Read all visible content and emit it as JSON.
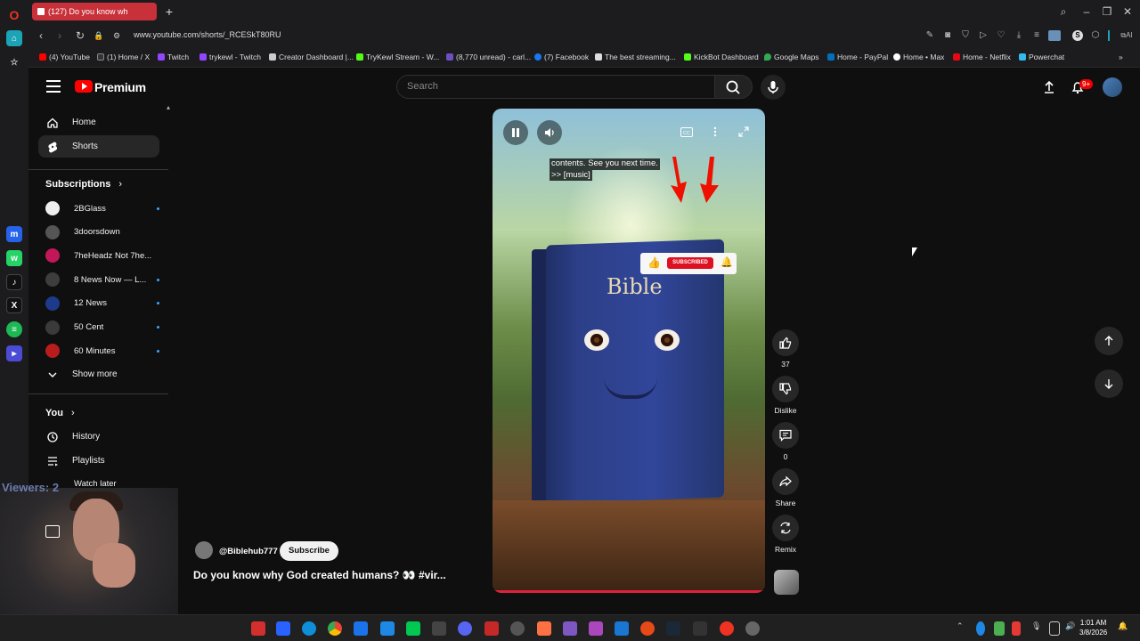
{
  "browser": {
    "tab_title": "(127) Do you know wh",
    "url": "www.youtube.com/shorts/_RCESkT80RU",
    "bookmarks": [
      "(4) YouTube",
      "(1) Home / X",
      "Twitch",
      "trykewl - Twitch",
      "Creator Dashboard |...",
      "TryKewl Stream - W...",
      "(8,770 unread) - carl...",
      "(7) Facebook",
      "The best streaming...",
      "KickBot Dashboard",
      "Google Maps",
      "Home - PayPal",
      "Home • Max",
      "Home - Netflix",
      "Powerchat"
    ]
  },
  "header": {
    "brand": "Premium",
    "search_placeholder": "Search",
    "notif_badge": "9+"
  },
  "sidebar": {
    "home": "Home",
    "shorts": "Shorts",
    "subscriptions_heading": "Subscriptions",
    "subscriptions": [
      {
        "name": "2BGlass",
        "live": true,
        "color": "#eeeeee"
      },
      {
        "name": "3doorsdown",
        "live": false,
        "color": "#555555"
      },
      {
        "name": "7heHeadz Not 7he...",
        "live": false,
        "color": "#c2185b"
      },
      {
        "name": "8 News Now — L...",
        "live": true,
        "color": "#3d3d3d"
      },
      {
        "name": "12 News",
        "live": true,
        "color": "#1e3a8a"
      },
      {
        "name": "50 Cent",
        "live": true,
        "color": "#3a3a3a"
      },
      {
        "name": "60 Minutes",
        "live": true,
        "color": "#b91c1c"
      }
    ],
    "show_more": "Show more",
    "you_heading": "You",
    "history": "History",
    "playlists": "Playlists",
    "watch_later": "Watch later"
  },
  "short": {
    "caption_line1": "contents. See you next time.",
    "caption_line2": ">> [music]",
    "book_title": "Bible",
    "subscribe_overlay": "SUBSCRIBED",
    "likes": "37",
    "dislike": "Dislike",
    "comments": "0",
    "share": "Share",
    "remix": "Remix",
    "channel": "@Biblehub777",
    "subscribe": "Subscribe",
    "title": "Do you know why God created humans? 👀 #vir..."
  },
  "overlay": {
    "viewers": "Viewers: 2"
  },
  "taskbar": {
    "time": "1:01 AM",
    "date": "3/8/2026"
  }
}
